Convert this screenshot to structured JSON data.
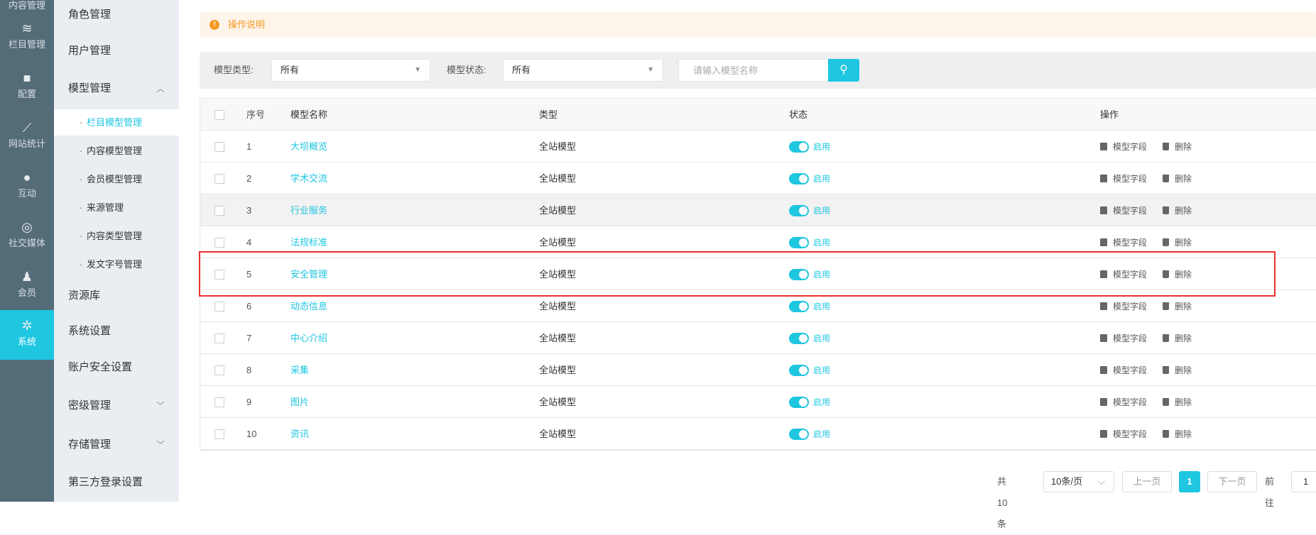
{
  "nav": {
    "top_partial": "内容管理",
    "items": [
      {
        "label": "栏目管理",
        "icon": "layers-icon"
      },
      {
        "label": "配置",
        "icon": "cube-icon"
      },
      {
        "label": "网站统计",
        "icon": "line-chart-icon"
      },
      {
        "label": "互动",
        "icon": "chat-icon"
      },
      {
        "label": "社交媒体",
        "icon": "target-icon"
      },
      {
        "label": "会员",
        "icon": "user-check-icon"
      },
      {
        "label": "系统",
        "icon": "gear-icon",
        "active": true
      }
    ]
  },
  "submenu": {
    "items": [
      "角色管理",
      "用户管理",
      "模型管理",
      "资源库",
      "系统设置",
      "账户安全设置",
      "密级管理",
      "存储管理",
      "第三方登录设置"
    ],
    "model_sub": [
      "栏目模型管理",
      "内容模型管理",
      "会员模型管理",
      "来源管理",
      "内容类型管理",
      "发文字号管理"
    ]
  },
  "notice": {
    "text": "操作说明",
    "icon": "!"
  },
  "filter": {
    "type_label": "模型类型:",
    "type_value": "所有",
    "status_label": "模型状态:",
    "status_value": "所有",
    "search_placeholder": "请输入模型名称"
  },
  "table": {
    "headers": [
      "序号",
      "模型名称",
      "类型",
      "状态",
      "操作"
    ],
    "rows": [
      {
        "no": "1",
        "name": "大坝概览",
        "type": "全站模型",
        "status": "启用"
      },
      {
        "no": "2",
        "name": "学术交流",
        "type": "全站模型",
        "status": "启用"
      },
      {
        "no": "3",
        "name": "行业服务",
        "type": "全站模型",
        "status": "启用"
      },
      {
        "no": "4",
        "name": "法规标准",
        "type": "全站模型",
        "status": "启用"
      },
      {
        "no": "5",
        "name": "安全管理",
        "type": "全站模型",
        "status": "启用"
      },
      {
        "no": "6",
        "name": "动态信息",
        "type": "全站模型",
        "status": "启用"
      },
      {
        "no": "7",
        "name": "中心介绍",
        "type": "全站模型",
        "status": "启用"
      },
      {
        "no": "8",
        "name": "采集",
        "type": "全站模型",
        "status": "启用"
      },
      {
        "no": "9",
        "name": "图片",
        "type": "全站模型",
        "status": "启用"
      },
      {
        "no": "10",
        "name": "资讯",
        "type": "全站模型",
        "status": "启用"
      }
    ],
    "op_fields": "模型字段",
    "op_delete": "删除"
  },
  "pager": {
    "total": "共 10 条",
    "page_size": "10条/页",
    "prev": "上一页",
    "current": "1",
    "next": "下一页",
    "goto": "前往",
    "goto_value": "1"
  },
  "colors": {
    "accent": "#1ec6e0",
    "sidebar": "#546b78",
    "highlight": "#ee2e2e"
  }
}
